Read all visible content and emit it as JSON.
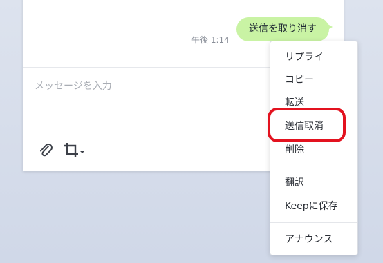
{
  "chat": {
    "message": {
      "text": "送信を取り消す",
      "time": "午後 1:14"
    },
    "composer": {
      "placeholder": "メッセージを入力",
      "value": ""
    },
    "toolbar": {
      "attach_icon": "paperclip-icon",
      "crop_icon": "crop-icon",
      "dropdown_icon": "caret-down-icon"
    }
  },
  "context_menu": {
    "items": [
      {
        "label": "リプライ"
      },
      {
        "label": "コピー"
      },
      {
        "label": "転送"
      },
      {
        "label": "送信取消"
      },
      {
        "label": "削除"
      },
      {
        "label": "翻訳"
      },
      {
        "label": "Keepに保存"
      },
      {
        "label": "アナウンス"
      }
    ]
  },
  "colors": {
    "bubble": "#c9f3a4",
    "highlight_ring": "#e3121f",
    "background": "#d5dcea"
  }
}
